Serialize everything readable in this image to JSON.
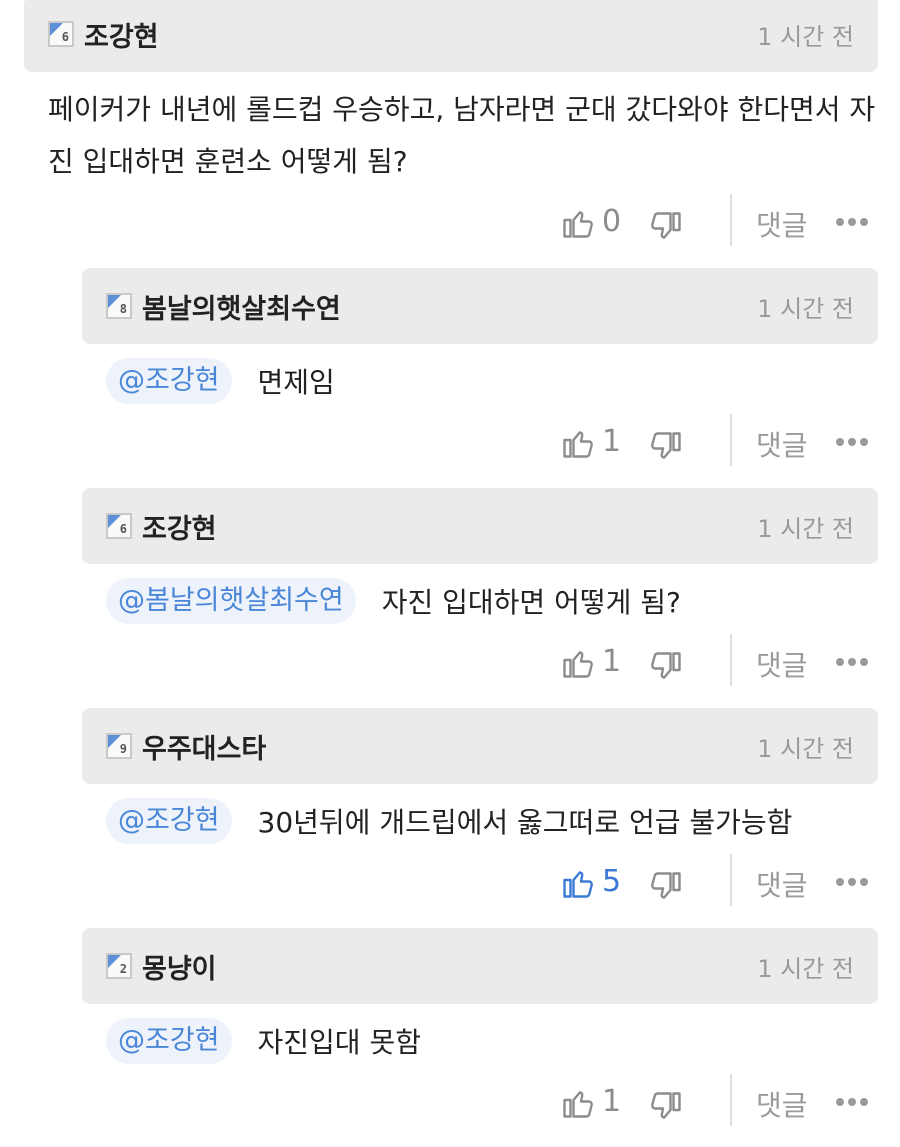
{
  "comments": [
    {
      "level": "6",
      "nickname": "조강현",
      "time": "1 시간 전",
      "text": "페이커가 내년에 롤드컵 우승하고, 남자라면 군대 갔다와야 한다면서 자진 입대하면 훈련소 어떻게 됨?",
      "likes": "0",
      "liked": false,
      "reply_label": "댓글"
    },
    {
      "level": "8",
      "nickname": "봄날의햇살최수연",
      "time": "1 시간 전",
      "mention": "@조강현",
      "text": "면제임",
      "likes": "1",
      "liked": false,
      "reply_label": "댓글"
    },
    {
      "level": "6",
      "nickname": "조강현",
      "time": "1 시간 전",
      "mention": "@봄날의햇살최수연",
      "text": "자진 입대하면 어떻게 됨?",
      "likes": "1",
      "liked": false,
      "reply_label": "댓글"
    },
    {
      "level": "9",
      "nickname": "우주대스타",
      "time": "1 시간 전",
      "mention": "@조강현",
      "text": "30년뒤에 개드립에서 옳그떠로 언급 불가능함",
      "likes": "5",
      "liked": true,
      "reply_label": "댓글"
    },
    {
      "level": "2",
      "nickname": "몽냥이",
      "time": "1 시간 전",
      "mention": "@조강현",
      "text": "자진입대 못함",
      "likes": "1",
      "liked": false,
      "reply_label": "댓글"
    }
  ],
  "colors": {
    "header_bg": "#ebebeb",
    "mention_fg": "#4a86d8",
    "mention_bg": "#eef3fb",
    "liked": "#3c7ad6",
    "muted": "#9a9a9a"
  },
  "icons": {
    "level": "level-badge-icon",
    "like": "thumbs-up-icon",
    "dislike": "thumbs-down-icon",
    "more": "more-dots-icon"
  }
}
